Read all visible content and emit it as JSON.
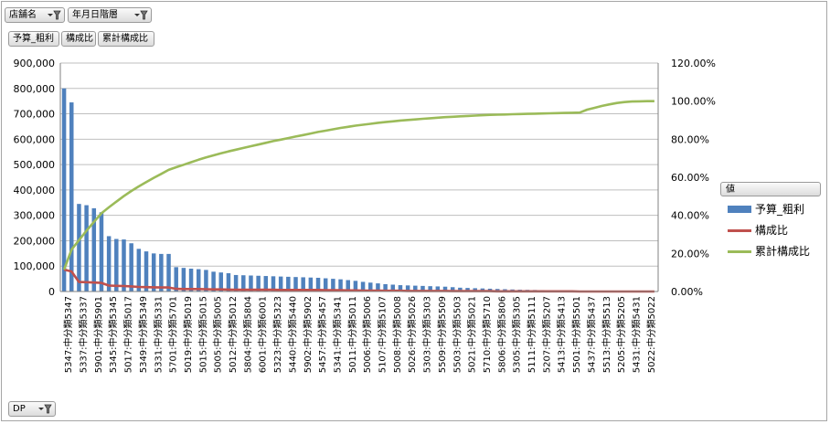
{
  "filters": {
    "store": "店舗名",
    "date": "年月日階層",
    "dp": "DP"
  },
  "fields": {
    "budget": "予算_粗利",
    "ratio": "構成比",
    "cumulative": "累計構成比"
  },
  "legend": {
    "title": "値",
    "items": [
      {
        "label": "予算_粗利",
        "color": "#4f81bd",
        "kind": "bar"
      },
      {
        "label": "構成比",
        "color": "#c0504d",
        "kind": "line"
      },
      {
        "label": "累計構成比",
        "color": "#9bbb59",
        "kind": "line"
      }
    ]
  },
  "chart_data": {
    "type": "bar",
    "title": "",
    "grid": true,
    "legend_position": "right",
    "y_left": {
      "min": 0,
      "max": 900000,
      "ticks": [
        "0",
        "100,000",
        "200,000",
        "300,000",
        "400,000",
        "500,000",
        "600,000",
        "700,000",
        "800,000",
        "900,000"
      ]
    },
    "y_right": {
      "min": 0,
      "max": 1.2,
      "ticks": [
        "0.00%",
        "20.00%",
        "40.00%",
        "60.00%",
        "80.00%",
        "100.00%",
        "120.00%"
      ]
    },
    "categories": [
      "5347:中分類5347",
      "5337:中分類5337",
      "5901:中分類5901",
      "5345:中分類5345",
      "5017:中分類5017",
      "5349:中分類5349",
      "5331:中分類5331",
      "5701:中分類5701",
      "5019:中分類5019",
      "5015:中分類5015",
      "5005:中分類5005",
      "5012:中分類5012",
      "5804:中分類5804",
      "6001:中分類6001",
      "5323:中分類5323",
      "5440:中分類5440",
      "5902:中分類5902",
      "5457:中分類5457",
      "5341:中分類5341",
      "5011:中分類5011",
      "5006:中分類5006",
      "5107:中分類5107",
      "5008:中分類5008",
      "5026:中分類5026",
      "5303:中分類5303",
      "5509:中分類5509",
      "5503:中分類5503",
      "5021:中分類5021",
      "5710:中分類5710",
      "5806:中分類5806",
      "5305:中分類5305",
      "5111:中分類5111",
      "5207:中分類5207",
      "5413:中分類5413",
      "5501:中分類5501",
      "5437:中分類5437",
      "5513:中分類5513",
      "5205:中分類5205",
      "5431:中分類5431",
      "5022:中分類5022"
    ],
    "series": [
      {
        "name": "予算_粗利",
        "axis": "left",
        "values": [
          800000,
          745000,
          345000,
          340000,
          328000,
          312000,
          218000,
          207000,
          205000,
          190000,
          168000,
          158000,
          150000,
          148000,
          148000,
          96000,
          93000,
          90000,
          88000,
          85000,
          78000,
          75000,
          72000,
          65000,
          64000,
          63000,
          62000,
          61000,
          60000,
          59000,
          58000,
          57000,
          56000,
          55000,
          54000,
          52000,
          50000,
          48000,
          45000,
          42000,
          38000,
          35000,
          32000,
          29000,
          27000,
          25000,
          24000,
          23000,
          22000,
          21000,
          20000,
          19000,
          17000,
          15000,
          14000,
          13000,
          12000,
          11000,
          10000,
          9000,
          8000,
          7000,
          6500,
          6000,
          5500,
          5000,
          4500,
          4000,
          3500,
          3000,
          2500,
          2200,
          2000,
          1800,
          1600,
          1400,
          1200,
          1000,
          900,
          800
        ]
      },
      {
        "name": "構成比",
        "axis": "right",
        "values": [
          0.115,
          0.105,
          0.05,
          0.049,
          0.047,
          0.045,
          0.031,
          0.03,
          0.029,
          0.027,
          0.024,
          0.023,
          0.022,
          0.021,
          0.021,
          0.014,
          0.013,
          0.013,
          0.013,
          0.012,
          0.011,
          0.011,
          0.01,
          0.009,
          0.009,
          0.009,
          0.009,
          0.009,
          0.009,
          0.008,
          0.008,
          0.008,
          0.008,
          0.008,
          0.008,
          0.007,
          0.007,
          0.007,
          0.006,
          0.006,
          0.005,
          0.005,
          0.005,
          0.004,
          0.004,
          0.004,
          0.003,
          0.003,
          0.003,
          0.003,
          0.003,
          0.003,
          0.002,
          0.002,
          0.002,
          0.002,
          0.002,
          0.002,
          0.001,
          0.001,
          0.001,
          0.001,
          0.001,
          0.001,
          0.001,
          0.001,
          0.001,
          0.001,
          0.001,
          0,
          0,
          0,
          0,
          0,
          0,
          0,
          0,
          0,
          0,
          0
        ]
      },
      {
        "name": "累計構成比",
        "axis": "right",
        "values": [
          0.115,
          0.22,
          0.27,
          0.319,
          0.366,
          0.411,
          0.442,
          0.472,
          0.501,
          0.528,
          0.552,
          0.575,
          0.597,
          0.618,
          0.639,
          0.653,
          0.666,
          0.679,
          0.692,
          0.704,
          0.715,
          0.726,
          0.736,
          0.745,
          0.754,
          0.763,
          0.772,
          0.781,
          0.79,
          0.798,
          0.806,
          0.814,
          0.822,
          0.83,
          0.838,
          0.845,
          0.852,
          0.859,
          0.865,
          0.871,
          0.876,
          0.881,
          0.886,
          0.89,
          0.894,
          0.898,
          0.901,
          0.904,
          0.907,
          0.91,
          0.913,
          0.916,
          0.918,
          0.92,
          0.922,
          0.924,
          0.926,
          0.928,
          0.929,
          0.93,
          0.931,
          0.932,
          0.933,
          0.934,
          0.935,
          0.936,
          0.937,
          0.938,
          0.939,
          0.94,
          0.955,
          0.965,
          0.975,
          0.983,
          0.99,
          0.995,
          0.998,
          0.999,
          1.0,
          1.0
        ]
      }
    ]
  }
}
